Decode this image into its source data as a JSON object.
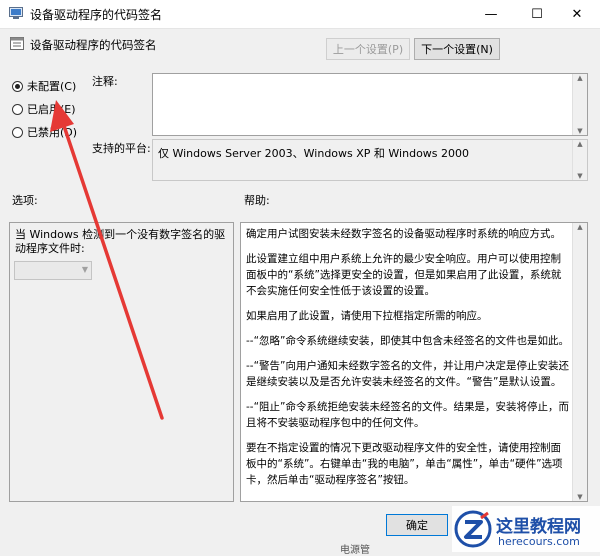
{
  "window": {
    "title": "设备驱动程序的代码签名",
    "subtitle": "设备驱动程序的代码签名",
    "minimize_glyph": "—",
    "maximize_glyph": "☐",
    "close_glyph": "✕"
  },
  "nav": {
    "prev_label": "上一个设置(P)",
    "next_label": "下一个设置(N)"
  },
  "state": {
    "options": [
      {
        "label": "未配置(C)",
        "checked": true
      },
      {
        "label": "已启用(E)",
        "checked": false
      },
      {
        "label": "已禁用(D)",
        "checked": false
      }
    ]
  },
  "comment": {
    "label": "注释:",
    "value": ""
  },
  "platform": {
    "label": "支持的平台:",
    "value": "仅 Windows Server 2003、Windows XP 和 Windows 2000"
  },
  "options_panel": {
    "label": "选项:",
    "description": "当 Windows 检测到一个没有数字签名的驱动程序文件时:",
    "dropdown_value": ""
  },
  "help_panel": {
    "label": "帮助:",
    "paragraphs": [
      "确定用户试图安装未经数字签名的设备驱动程序时系统的响应方式。",
      "此设置建立组中用户系统上允许的最少安全响应。用户可以使用控制面板中的“系统”选择更安全的设置，但是如果启用了此设置，系统就不会实施任何安全性低于该设置的设置。",
      "如果启用了此设置，请使用下拉框指定所需的响应。",
      "--“忽略”命令系统继续安装，即使其中包含未经签名的文件也是如此。",
      "--“警告”向用户通知未经数字签名的文件，并让用户决定是停止安装还是继续安装以及是否允许安装未经签名的文件。“警告”是默认设置。",
      "--“阻止”命令系统拒绝安装未经签名的文件。结果是，安装将停止，而且将不安装驱动程序包中的任何文件。",
      "要在不指定设置的情况下更改驱动程序文件的安全性，请使用控制面板中的“系统”。右键单击“我的电脑”，单击“属性”，单击“硬件”选项卡，然后单击“驱动程序签名”按钮。"
    ]
  },
  "footer": {
    "ok_label": "确定",
    "partial_label": "电源管"
  },
  "watermark": {
    "title": "这里教程网",
    "url": "herecours.com"
  },
  "colors": {
    "annotation_red": "#e53935",
    "accent_blue": "#0078d7",
    "watermark_blue": "#1e4fa8"
  }
}
